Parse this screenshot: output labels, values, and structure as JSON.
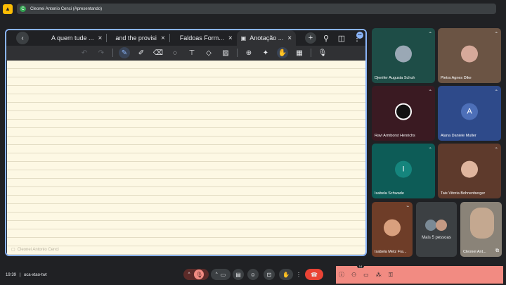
{
  "topbar": {
    "presenter_label": "Cleonei Antonio Cenci (Apresentando)",
    "presenter_initial": "C"
  },
  "browser": {
    "tabs": [
      {
        "label": "A quem tude ...",
        "close": "×"
      },
      {
        "label": "and the provisi",
        "close": "×"
      },
      {
        "label": "Faldoas Form...",
        "close": "×"
      },
      {
        "label": "Anotação ...",
        "close": "×"
      }
    ],
    "active_tab_index": 3
  },
  "paper": {
    "footer_label": "Cleonei Antonio Cenci"
  },
  "participants": [
    {
      "name": "Djenifer Augusta Schuh",
      "bg": "#1e4d47",
      "kind": "photo",
      "photo_color": "#9aa8b5"
    },
    {
      "name": "Pietra Agnes Dike",
      "bg": "#6b5444",
      "kind": "photo",
      "photo_color": "#d6a99a"
    },
    {
      "name": "Ravi Armborst Henrichs",
      "bg": "#3a1a22",
      "kind": "photo",
      "photo_color": "#111111"
    },
    {
      "name": "Alana Daniele Muller",
      "bg": "#2e4a8a",
      "kind": "letter",
      "letter": "A",
      "photo_color": "#4d6fb8"
    },
    {
      "name": "Isabela Schwade",
      "bg": "#0d5c57",
      "kind": "letter",
      "letter": "I",
      "photo_color": "#15857d"
    },
    {
      "name": "Tais Vitoria Bohnenberger",
      "bg": "#5e3a2c",
      "kind": "photo",
      "photo_color": "#e0b59e"
    },
    {
      "name": "Isabela Metz Fra...",
      "bg": "#6e3d28",
      "kind": "photo",
      "photo_color": "#d9a07e"
    },
    {
      "name": "Mais 5 pessoas",
      "bg": "#3c4043",
      "kind": "group"
    },
    {
      "name": "Cleonei Ant...",
      "bg": "#8a8378",
      "kind": "photo",
      "photo_color": "#c4a890"
    }
  ],
  "bottombar": {
    "time": "19:39",
    "separator": "|",
    "meeting_code": "uca-xtao-twt",
    "people_count": "14"
  },
  "colors": {
    "accent": "#8ab4f8",
    "end_call": "#ea4335",
    "panel": "#f28b82"
  }
}
